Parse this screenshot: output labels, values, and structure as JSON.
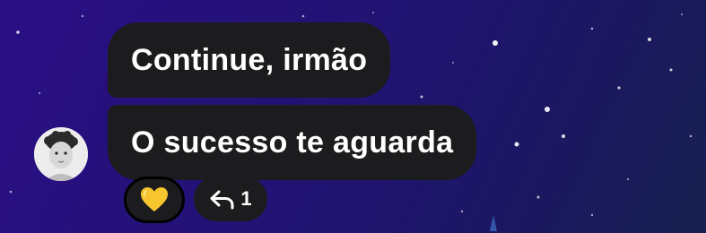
{
  "messages": [
    {
      "text": "Continue, irmão"
    },
    {
      "text": "O sucesso te aguarda"
    }
  ],
  "sender": {
    "avatar_icon": "child-portrait"
  },
  "reaction": {
    "emoji": "yellow-heart",
    "color": "#f7c62f"
  },
  "replies": {
    "icon": "reply-arrow-icon",
    "count": "1"
  },
  "colors": {
    "bubble": "#1c1c1f",
    "background_top": "#2a0f86",
    "background_bottom": "#17214f"
  }
}
